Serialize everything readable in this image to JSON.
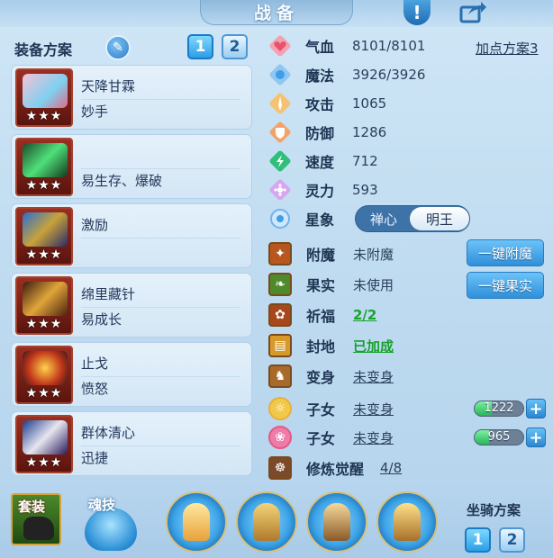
{
  "header": {
    "title": "战备"
  },
  "equip_scheme": {
    "label": "装备方案",
    "buttons": [
      "1",
      "2"
    ],
    "active": 0
  },
  "cards": [
    {
      "name": "天降甘霖",
      "trait": "妙手",
      "stars": "★★★"
    },
    {
      "name": "",
      "trait": "易生存、爆破",
      "stars": "★★★"
    },
    {
      "name": "激励",
      "trait": "",
      "stars": "★★★"
    },
    {
      "name": "绵里藏针",
      "trait": "易成长",
      "stars": "★★★"
    },
    {
      "name": "止戈",
      "trait": "愤怒",
      "stars": "★★★"
    },
    {
      "name": "群体清心",
      "trait": "迅捷",
      "stars": "★★★"
    }
  ],
  "stats": [
    {
      "name": "气血",
      "value": "8101/8101",
      "icon": "heart-icon",
      "color": "#e8536a"
    },
    {
      "name": "魔法",
      "value": "3926/3926",
      "icon": "mana-icon",
      "color": "#3f9ee8"
    },
    {
      "name": "攻击",
      "value": "1065",
      "icon": "sword-icon",
      "color": "#f0a63a"
    },
    {
      "name": "防御",
      "value": "1286",
      "icon": "shield-icon",
      "color": "#f08a3a"
    },
    {
      "name": "速度",
      "value": "712",
      "icon": "speed-icon",
      "color": "#2fbf7a"
    },
    {
      "name": "灵力",
      "value": "593",
      "icon": "spirit-icon",
      "color": "#c07de6"
    }
  ],
  "plan_link": "加点方案3",
  "star_sign": {
    "label": "星象",
    "options": [
      "禅心",
      "明王"
    ],
    "selected": 1
  },
  "enhance": [
    {
      "key": "附魔",
      "value": "未附魔",
      "style": "plain",
      "icon": "enchant-icon",
      "button": "一键附魔"
    },
    {
      "key": "果实",
      "value": "未使用",
      "style": "plain",
      "icon": "fruit-icon",
      "button": "一键果实"
    },
    {
      "key": "祈福",
      "value": "2/2",
      "style": "green",
      "icon": "bless-icon"
    },
    {
      "key": "封地",
      "value": "已加成",
      "style": "green",
      "icon": "fief-icon"
    },
    {
      "key": "变身",
      "value": "未变身",
      "style": "underline",
      "icon": "transform-icon"
    },
    {
      "key": "子女",
      "value": "未变身",
      "style": "underline",
      "icon": "child-icon-1",
      "bar": "1222",
      "bar_fill": 0.35
    },
    {
      "key": "子女",
      "value": "未变身",
      "style": "underline",
      "icon": "child-icon-2",
      "bar": "965",
      "bar_fill": 0.3
    },
    {
      "key": "修炼觉醒",
      "value": "4/8",
      "style": "underline",
      "icon": "cultivation-icon"
    }
  ],
  "bottom": {
    "suit_label": "套装",
    "soul_label": "魂技",
    "mount_label": "坐骑方案",
    "mount_buttons": [
      "1",
      "2"
    ]
  }
}
